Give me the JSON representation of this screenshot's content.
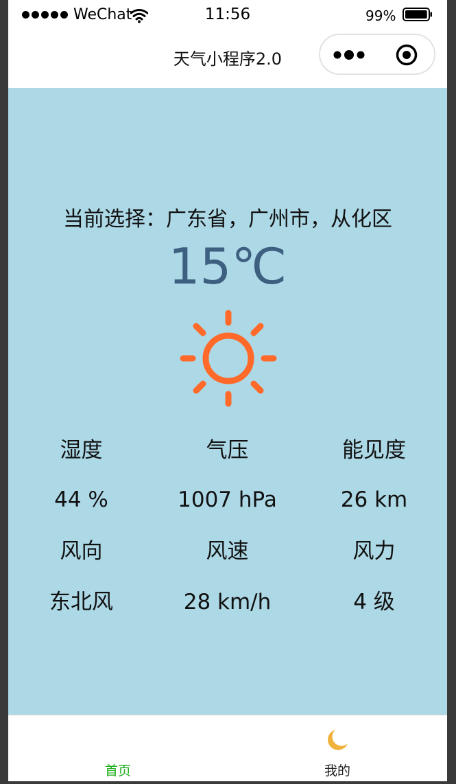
{
  "status_bar": {
    "carrier": "WeChat",
    "time": "11:56",
    "battery_percent": "99%",
    "battery_level": 0.99,
    "signal_icon": "signal-dots-icon",
    "wifi_icon": "wifi-icon",
    "battery_icon": "battery-icon"
  },
  "nav": {
    "title": "天气小程序2.0",
    "more_icon": "more-dots-icon",
    "close_icon": "target-close-icon"
  },
  "weather": {
    "location": "当前选择：广东省，广州市，从化区",
    "temperature": "15℃",
    "icon": "sun-icon",
    "metrics": [
      {
        "label": "湿度",
        "value": "44 %"
      },
      {
        "label": "气压",
        "value": "1007 hPa"
      },
      {
        "label": "能见度",
        "value": "26 km"
      },
      {
        "label": "风向",
        "value": "东北风"
      },
      {
        "label": "风速",
        "value": "28 km/h"
      },
      {
        "label": "风力",
        "value": "4 级"
      }
    ]
  },
  "tab_bar": {
    "tabs": [
      {
        "label": "首页",
        "active": true
      },
      {
        "label": "我的",
        "active": false,
        "icon": "moon-icon"
      }
    ]
  },
  "colors": {
    "background": "#add8e6",
    "temperature": "#3d5f80",
    "sun": "#ff6a2a",
    "moon": "#f0b23a",
    "tab_active": "#1aad19"
  }
}
